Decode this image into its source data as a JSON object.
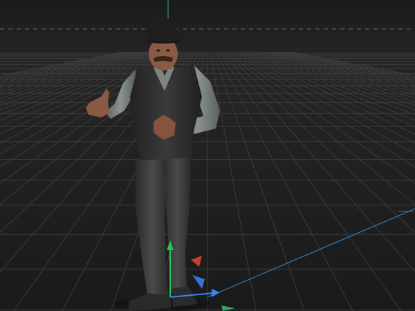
{
  "viewport": {
    "background": "#1c1c1c",
    "grid_color": "#3c3c3c",
    "horizon_color": "#6a6a6a",
    "y_axis_color": "#2bb38a",
    "x_axis_color": "#2f7fbf"
  },
  "gizmo": {
    "y_color": "#22c55e",
    "x_color": "#3b82f6",
    "z_color": "#e0473a"
  },
  "character": {
    "subject": "3d-character-man-in-bowler-hat",
    "skin": "#8a5a44",
    "vest": "#2d2d2d",
    "shirt": "#6f7772",
    "trousers": "#3a3a3a",
    "hat": "#1f1f1f"
  }
}
